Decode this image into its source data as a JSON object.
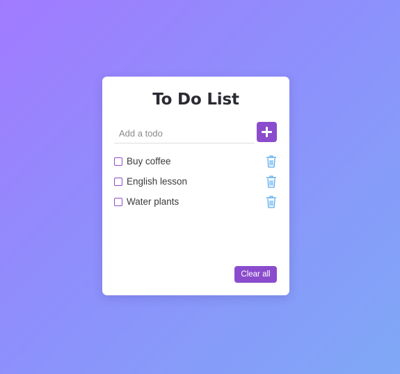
{
  "app": {
    "title": "To Do List",
    "input_placeholder": "Add a todo",
    "input_value": "",
    "add_icon": "plus-icon",
    "clear_label": "Clear all",
    "accent_color": "#8a4ccc",
    "delete_icon_color": "#5aa9f0"
  },
  "todos": [
    {
      "text": "Buy coffee",
      "done": false,
      "delete_icon": "trash-icon"
    },
    {
      "text": "English lesson",
      "done": false,
      "delete_icon": "trash-icon"
    },
    {
      "text": "Water plants",
      "done": false,
      "delete_icon": "trash-icon"
    }
  ]
}
